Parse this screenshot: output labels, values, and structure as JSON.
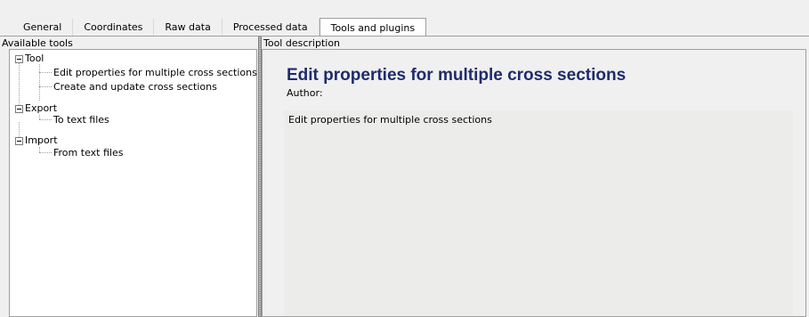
{
  "tabs": [
    {
      "label": "General"
    },
    {
      "label": "Coordinates"
    },
    {
      "label": "Raw data"
    },
    {
      "label": "Processed data"
    },
    {
      "label": "Tools and plugins"
    }
  ],
  "active_tab": "Tools and plugins",
  "left_pane": {
    "label": "Available tools",
    "tree": [
      {
        "label": "Tool",
        "expanded": true,
        "children": [
          {
            "label": "Edit properties for multiple cross sections"
          },
          {
            "label": "Create and update cross sections"
          }
        ]
      },
      {
        "label": "Export",
        "expanded": true,
        "children": [
          {
            "label": "To text files"
          }
        ]
      },
      {
        "label": "Import",
        "expanded": true,
        "children": [
          {
            "label": "From text files"
          }
        ]
      }
    ]
  },
  "right_pane": {
    "label": "Tool description",
    "title": "Edit properties for multiple cross sections",
    "author_label": "Author:",
    "description": "Edit properties for multiple cross sections"
  },
  "colors": {
    "title": "#1f2b6b",
    "window_bg": "#f0f0f0",
    "border": "#a0a0a0"
  }
}
